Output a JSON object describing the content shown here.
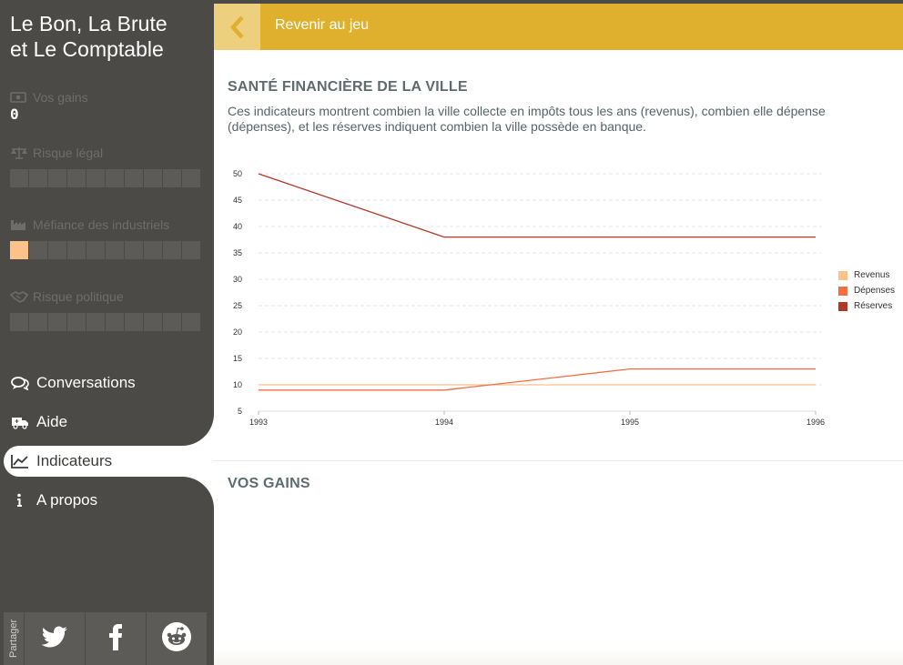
{
  "sidebar": {
    "title_line1": "Le Bon, La Brute",
    "title_line2": "et Le Comptable",
    "gains": {
      "label": "Vos gains",
      "value": "0",
      "icon": "money-icon"
    },
    "legal_risk": {
      "label": "Risque légal",
      "level": 0,
      "cells": 10,
      "icon": "scales-icon"
    },
    "industry_distrust": {
      "label": "Méfiance des industriels",
      "level": 1,
      "cells": 10,
      "icon": "factory-icon"
    },
    "political_risk": {
      "label": "Risque politique",
      "level": 0,
      "cells": 10,
      "icon": "handshake-icon"
    },
    "nav": [
      {
        "label": "Conversations",
        "icon": "chat-icon"
      },
      {
        "label": "Aide",
        "icon": "ambulance-icon"
      },
      {
        "label": "Indicateurs",
        "icon": "chart-line-icon",
        "active": true
      },
      {
        "label": "A propos",
        "icon": "info-icon"
      }
    ],
    "share": {
      "label": "Partager",
      "buttons": [
        "twitter-icon",
        "facebook-icon",
        "reddit-icon"
      ]
    }
  },
  "header": {
    "back_label": "Revenir au jeu"
  },
  "main": {
    "finance_title": "SANTÉ FINANCIÈRE DE LA VILLE",
    "finance_desc": "Ces indicateurs montrent combien la ville collecte en impôts tous les ans (revenus), combien elle dépense (dépenses), et les réserves indiquent combien la ville possède en banque.",
    "gains_title": "VOS GAINS"
  },
  "colors": {
    "accent": "#deb02e",
    "sidebar": "#4b4a47",
    "gauge_on": "#fdc18a"
  },
  "chart_data": {
    "type": "line",
    "x": [
      1993,
      1994,
      1995,
      1996
    ],
    "ylim": [
      5,
      50
    ],
    "yticks": [
      5,
      10,
      15,
      20,
      25,
      30,
      35,
      40,
      45,
      50
    ],
    "grid": true,
    "legend_position": "right",
    "series": [
      {
        "name": "Revenus",
        "color": "#fdc18a",
        "values": [
          10,
          10,
          10,
          10
        ]
      },
      {
        "name": "Dépenses",
        "color": "#f46d43",
        "values": [
          9,
          9,
          13,
          13
        ]
      },
      {
        "name": "Réserves",
        "color": "#b2382a",
        "values": [
          50,
          38,
          38,
          38
        ]
      }
    ]
  }
}
